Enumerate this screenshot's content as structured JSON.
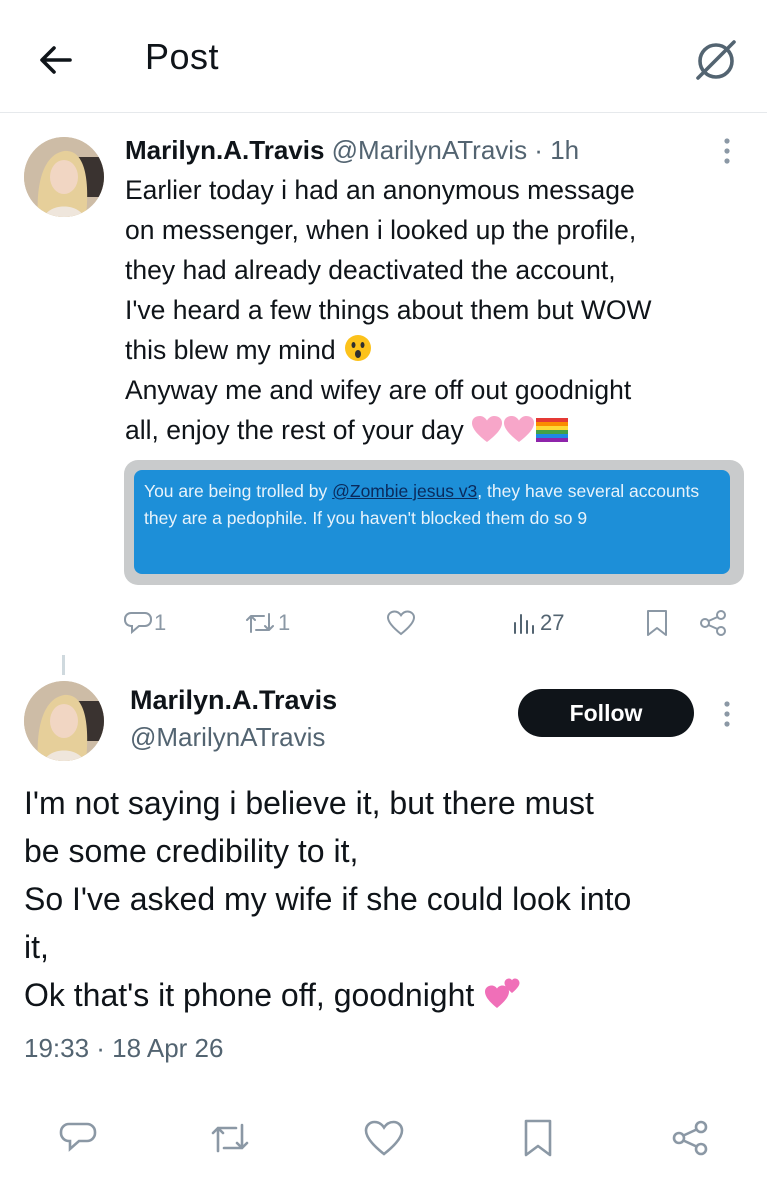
{
  "header": {
    "title": "Post",
    "back_icon": "arrow-left-icon",
    "grok_icon": "grok-icon"
  },
  "parent_tweet": {
    "display_name": "Marilyn.A.Travis",
    "handle": "@MarilynATravis",
    "separator": "·",
    "time_ago": "1h",
    "text_lines": [
      "Earlier today i had an anonymous message",
      "on messenger, when i looked up the profile,",
      "they had already deactivated the account,",
      "I've heard a few things about them but WOW",
      "this blew my mind",
      "Anyway me and wifey are off out goodnight",
      "all, enjoy the rest of your day"
    ],
    "media": {
      "text_before": "You are being trolled by ",
      "mention": "@Zombie jesus v3",
      "text_after": ", they have several accounts they are a pedophile. If you haven't blocked them do so 9"
    },
    "actions": {
      "reply_count": "1",
      "repost_count": "1",
      "like_count": "",
      "view_count": "27"
    }
  },
  "main_tweet": {
    "display_name": "Marilyn.A.Travis",
    "handle": "@MarilynATravis",
    "follow_label": "Follow",
    "text_lines": [
      "I'm not saying i believe it, but there must",
      "be some credibility to it,",
      "So I've asked my wife if she could look into",
      "it,",
      "Ok that's it phone off, goodnight"
    ],
    "timestamp": "19:33 · 18 Apr 26"
  },
  "colors": {
    "text_primary": "#0f1419",
    "text_secondary": "#536471",
    "icon_gray": "#8b98a5",
    "follow_bg": "#0f1419",
    "media_blue": "#1d8fd8"
  },
  "bottom_bar_icons": [
    "reply-icon",
    "repost-icon",
    "like-icon",
    "bookmark-icon",
    "share-icon"
  ]
}
